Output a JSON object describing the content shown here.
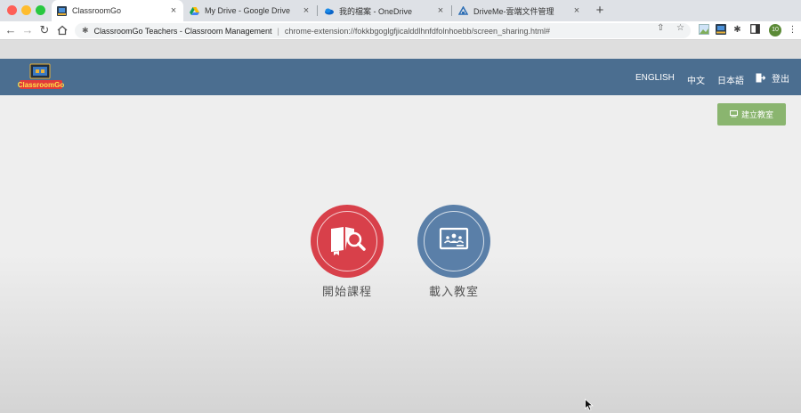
{
  "browser": {
    "tabs": [
      {
        "title": "ClassroomGo",
        "active": true,
        "icon": "classroomgo-icon"
      },
      {
        "title": "My Drive - Google Drive",
        "active": false,
        "icon": "google-drive-icon"
      },
      {
        "title": "我的檔案 - OneDrive",
        "active": false,
        "icon": "onedrive-icon"
      },
      {
        "title": "DriveMe-雲端文件管理",
        "active": false,
        "icon": "driveme-icon"
      }
    ],
    "omnibox": {
      "page_title": "ClassroomGo Teachers - Classroom Management",
      "url": "chrome-extension://fokkbgoglgfjicalddlhnfdfolnhoebb/screen_sharing.html#"
    },
    "profile_initials": "10"
  },
  "app": {
    "logo_text": "ClassroomGo",
    "nav": {
      "english": "ENGLISH",
      "chinese": "中文",
      "japanese": "日本語",
      "logout": "登出"
    },
    "create_classroom_label": "建立教室",
    "actions": {
      "start_lesson": "開始課程",
      "load_classroom": "載入教室"
    }
  },
  "colors": {
    "header": "#4b6e90",
    "start_lesson": "#d8404a",
    "load_classroom": "#5a7fa8",
    "create_button": "#8ab56f"
  }
}
